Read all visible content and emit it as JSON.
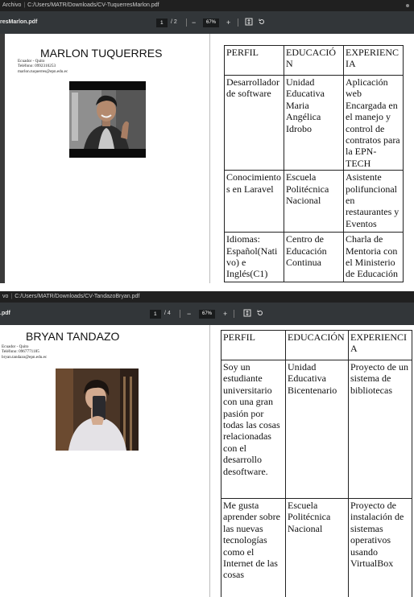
{
  "colors": {
    "pathbar_bg": "#202020",
    "toolbar_bg": "#323639",
    "page_bg": "#ffffff"
  },
  "viewers": [
    {
      "path_app": "Archivo",
      "path": "C:/Users/MATR/Downloads/CV-TuquerresMarlon.pdf",
      "file_tab": "resMarlon.pdf",
      "page_current": "1",
      "page_total": "/ 2",
      "zoom": "67%",
      "icons": [
        "zoom-out-icon",
        "zoom-in-icon",
        "fit-page-icon",
        "rotate-icon"
      ],
      "cv": {
        "name": "MARLON TUQUERRES",
        "info": [
          "Ecuador - Quito",
          "Teléfono: 0992310253",
          "marlon.tuquerres@epn.edu.ec"
        ],
        "table": [
          [
            "PERFIL",
            "EDUCACIÓN",
            "EXPERIENCIA"
          ],
          [
            "Desarrollador de software",
            "Unidad Educativa Maria Angélica Idrobo",
            "Aplicación web Encargada en el manejo y control de contratos para la EPN-TECH"
          ],
          [
            "Conocimientos en Laravel",
            "Escuela Politécnica Nacional",
            "Asistente polifuncional en restaurantes y Eventos"
          ],
          [
            "Idiomas: Español(Nativo) e Inglés(C1)",
            "Centro de Educación Continua",
            "Charla de Mentoria con el Ministerio de Educación"
          ]
        ]
      }
    },
    {
      "path_app": "vo",
      "path": "C:/Users/MATR/Downloads/CV-TandazoBryan.pdf",
      "file_tab": ".pdf",
      "page_current": "1",
      "page_total": "/ 4",
      "zoom": "67%",
      "icons": [
        "zoom-out-icon",
        "zoom-in-icon",
        "fit-page-icon",
        "rotate-icon"
      ],
      "cv": {
        "name": "BRYAN TANDAZO",
        "info": [
          "Ecuador - Quito",
          "Teléfono: 0967771185",
          "bryan.tandazo@epn.edu.ec"
        ],
        "table": [
          [
            "PERFIL",
            "EDUCACIÓN",
            "EXPERIENCIA"
          ],
          [
            "Soy un estudiante universitario con una gran pasión por todas las cosas relacionadas con el desarrollo desoftware.",
            "Unidad Educativa Bicentenario",
            "Proyecto de un sistema de bibliotecas"
          ],
          [
            "Me gusta aprender sobre las nuevas tecnologías como el Internet de las cosas",
            "Escuela Politécnica Nacional",
            "Proyecto de instalación de sistemas operativos usando VirtualBox"
          ]
        ]
      }
    }
  ]
}
